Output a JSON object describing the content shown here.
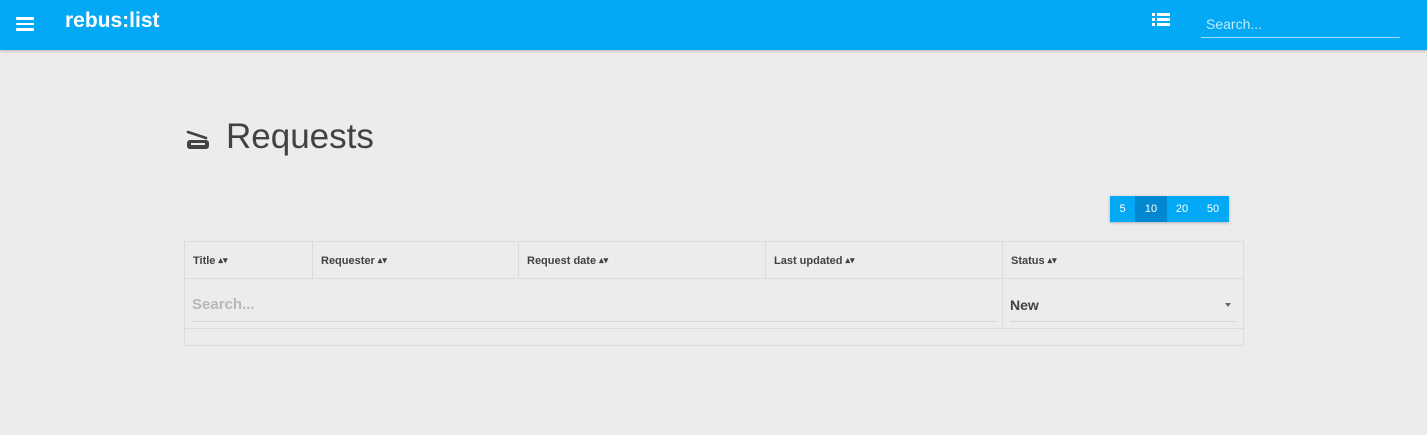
{
  "app": {
    "title": "rebus:list"
  },
  "header": {
    "search_placeholder": "Search..."
  },
  "page": {
    "title": "Requests"
  },
  "pager": {
    "options": [
      "5",
      "10",
      "20",
      "50"
    ],
    "selected": "10"
  },
  "table": {
    "columns": [
      {
        "label": "Title",
        "sort_icon": "sort-icon"
      },
      {
        "label": "Requester",
        "sort_icon": "sort-icon"
      },
      {
        "label": "Request date",
        "sort_icon": "sort-icon"
      },
      {
        "label": "Last updated",
        "sort_icon": "sort-icon"
      },
      {
        "label": "Status",
        "sort_icon": "sort-icon"
      }
    ],
    "filter": {
      "search_placeholder": "Search...",
      "status_value": "New"
    },
    "rows": []
  },
  "colors": {
    "primary": "#03a9f4",
    "primary_dark": "#0288d1",
    "background": "#ececec"
  }
}
